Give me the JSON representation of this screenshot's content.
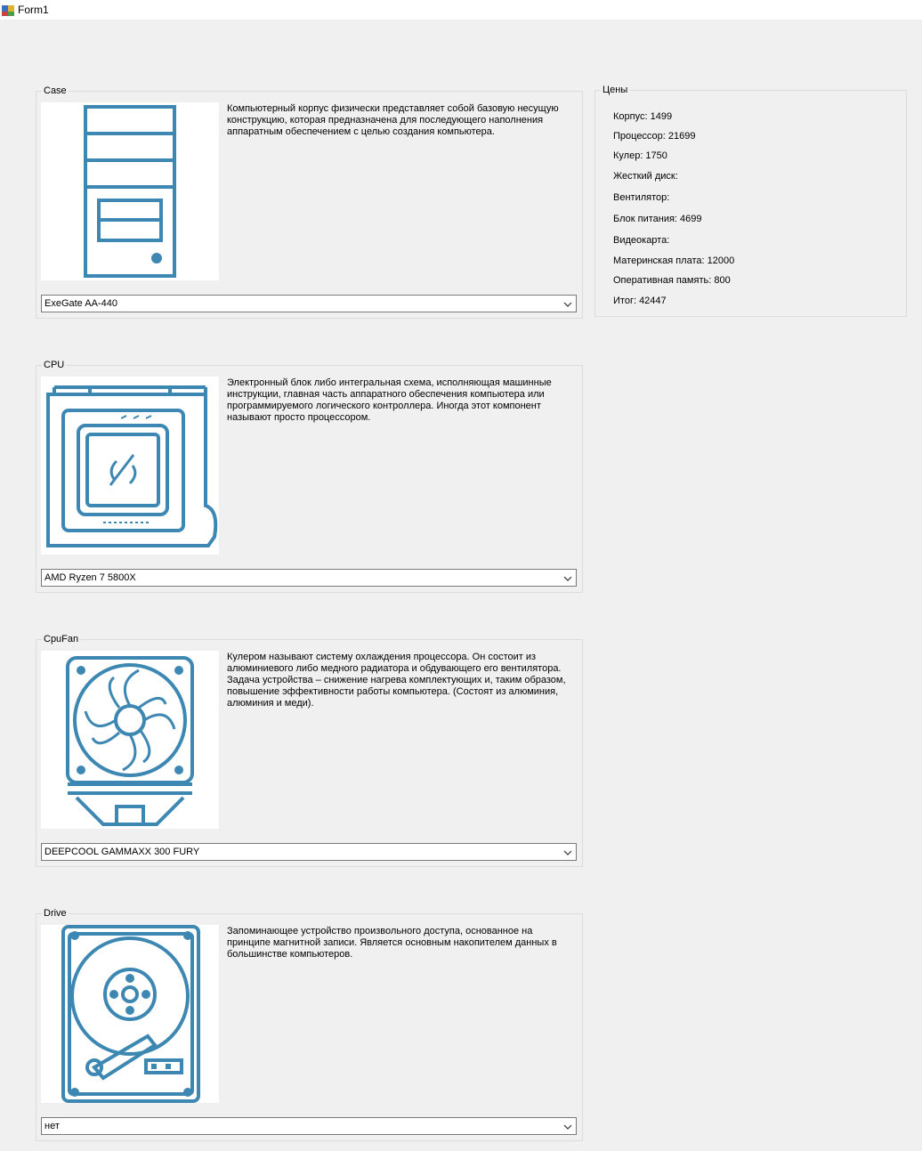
{
  "window": {
    "title": "Form1"
  },
  "sections": [
    {
      "label": "Case",
      "icon": "pc-case-icon",
      "description": "Компьютерный корпус физически представляет собой базовую несущую конструкцию, которая предназначена для последующего наполнения аппаратным обеспечением с целью создания компьютера.",
      "selected": "ExeGate AA-440"
    },
    {
      "label": "CPU",
      "icon": "cpu-icon",
      "description": "Электронный блок либо интегральная схема, исполняющая машинные инструкции, главная часть аппаратного обеспечения компьютера или программируемого логического контроллера. Иногда этот компонент называют просто процессором.",
      "selected": "AMD Ryzen 7 5800X"
    },
    {
      "label": "CpuFan",
      "icon": "cpu-fan-icon",
      "description": "Кулером называют систему охлаждения процессора. Он состоит из алюминиевого либо медного радиатора и обдувающего его вентилятора. Задача устройства – снижение нагрева комплектующих и, таким образом, повышение эффективности работы компьютера. (Состоят из алюминия, алюминия и меди).",
      "selected": "DEEPCOOL GAMMAXX 300 FURY"
    },
    {
      "label": "Drive",
      "icon": "hard-drive-icon",
      "description": "Запоминающее устройство произвольного доступа, основанное на принципе магнитной записи. Является основным накопителем данных в большинстве компьютеров.",
      "selected": "нет"
    }
  ],
  "prices": {
    "label": "Цены",
    "lines": [
      "Корпус: 1499",
      "Процессор: 21699",
      "Кулер: 1750",
      "Жесткий диск:",
      "Вентилятор:",
      "Блок питания: 4699",
      "Видеокарта:",
      "Материнская плата: 12000",
      "Оперативная память: 800",
      "Итог: 42447"
    ]
  },
  "colors": {
    "icon_stroke": "#3d87b3",
    "background": "#f0f0f0",
    "border": "#dcdcdc"
  }
}
